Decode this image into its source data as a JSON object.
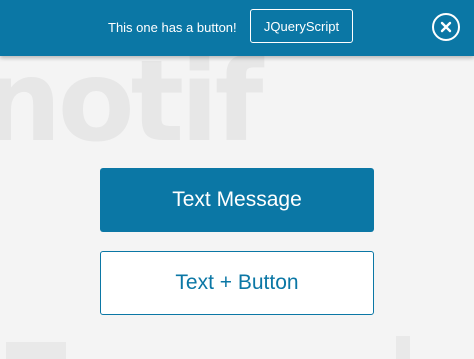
{
  "background": {
    "logo_text": "notif"
  },
  "notification": {
    "message": "This one has a button!",
    "button_label": "JQueryScript",
    "close_icon": "close-icon",
    "bar_color": "#0b77a5"
  },
  "demo": {
    "text_message_label": "Text Message",
    "text_button_label": "Text + Button",
    "accent_color": "#0b77a5"
  }
}
